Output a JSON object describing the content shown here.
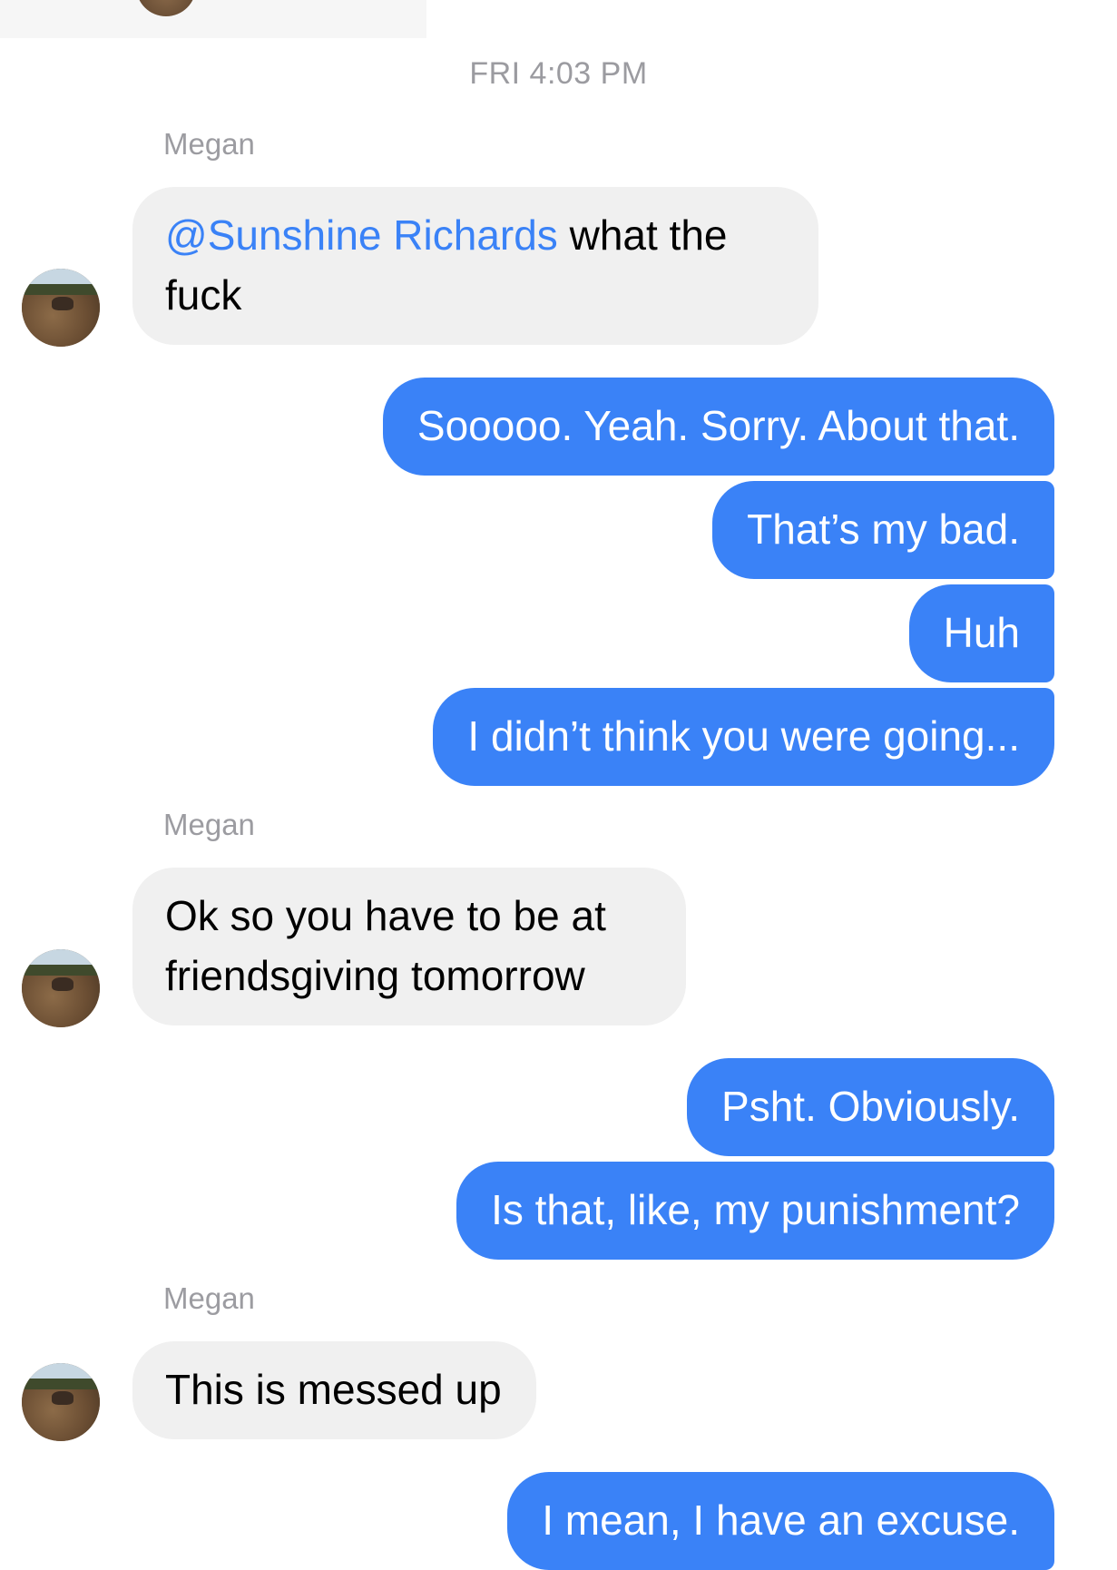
{
  "header": {
    "timestamp": "FRI 4:03 PM"
  },
  "thread": {
    "contact_name": "Megan",
    "groups": [
      {
        "sender": "Megan",
        "incoming": [
          {
            "mention": "@Sunshine Richards",
            "line1_rest": " what the",
            "line2": "fuck"
          }
        ]
      },
      {
        "outgoing": [
          "Sooooo. Yeah. Sorry. About that.",
          "That’s my bad.",
          "Huh",
          "I didn’t think you were going..."
        ]
      },
      {
        "sender": "Megan",
        "incoming": [
          {
            "line1": "Ok so you have to be at",
            "line2": "friendsgiving tomorrow"
          }
        ]
      },
      {
        "outgoing": [
          "Psht. Obviously.",
          "Is that, like, my punishment?"
        ]
      },
      {
        "sender": "Megan",
        "incoming": [
          {
            "line1": "This is messed up"
          }
        ]
      },
      {
        "outgoing": [
          "I mean, I have an excuse."
        ]
      }
    ]
  },
  "colors": {
    "outgoing_bubble": "#3a82f7",
    "incoming_bubble": "#f0f0f0",
    "mention": "#3a82f7",
    "meta_text": "#9b9ba0"
  },
  "icons": {
    "contact_avatar": "profile-photo-avatar"
  }
}
